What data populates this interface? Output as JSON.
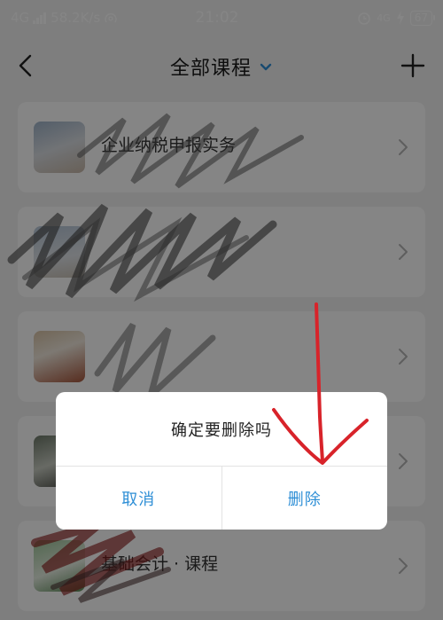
{
  "status_bar": {
    "network": "4G",
    "speed": "58.2K/s",
    "time": "21:02",
    "right_network": "4G",
    "battery": "67"
  },
  "nav": {
    "title": "全部课程",
    "back_icon": "back-arrow-icon",
    "dropdown_icon": "chevron-down-icon",
    "add_icon": "plus-icon"
  },
  "courses": [
    {
      "title": "企业纳税申报实务",
      "subtitle": ""
    },
    {
      "title": "",
      "subtitle": ""
    },
    {
      "title": "",
      "subtitle": ""
    },
    {
      "title": "",
      "subtitle": ""
    },
    {
      "title": "基础会计 · 课程",
      "subtitle": ""
    }
  ],
  "dialog": {
    "message": "确定要删除吗",
    "cancel_label": "取消",
    "delete_label": "删除"
  },
  "colors": {
    "accent": "#2f8fd6",
    "annotation": "#d8232a"
  }
}
